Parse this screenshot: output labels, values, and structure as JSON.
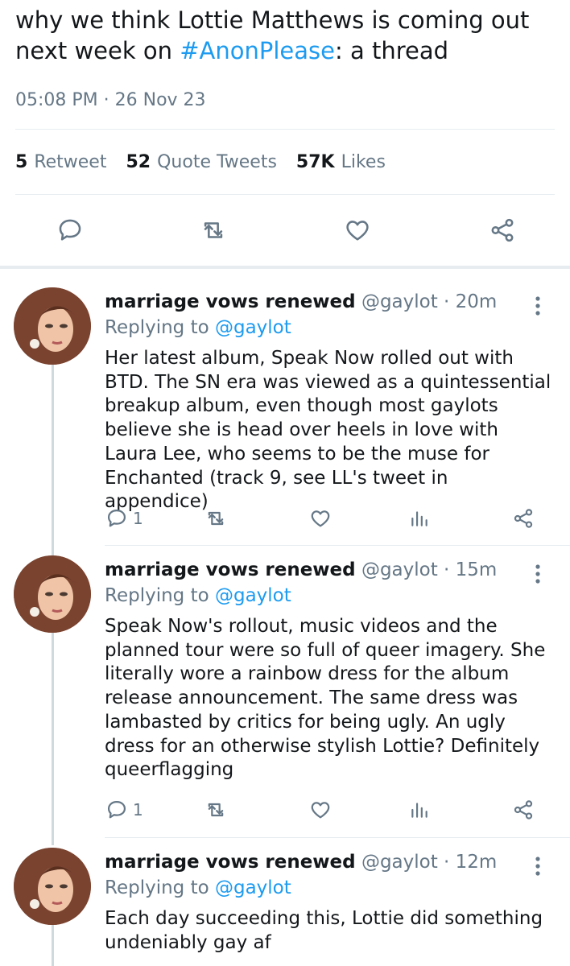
{
  "main_tweet": {
    "text_before": "why we think Lottie Matthews is coming out next week on ",
    "hashtag": "#AnonPlease",
    "text_after": ": a thread",
    "timestamp": "05:08 PM · 26 Nov 23",
    "stats": {
      "retweets_count": "5",
      "retweets_label": "Retweet",
      "quotes_count": "52",
      "quotes_label": "Quote Tweets",
      "likes_count": "57K",
      "likes_label": "Likes"
    }
  },
  "replies": [
    {
      "display_name": "marriage vows renewed",
      "handle": "@gaylot",
      "time": "· 20m",
      "replying_prefix": "Replying to",
      "replying_to": "@gaylot",
      "text": "Her latest album, Speak Now rolled out with BTD. The SN era was viewed as a quintessential breakup album, even though most gaylots believe she is head over heels in love with Laura Lee, who seems to be the muse for Enchanted (track 9, see LL's tweet in appendice)",
      "reply_count": "1"
    },
    {
      "display_name": "marriage vows renewed",
      "handle": "@gaylot",
      "time": "· 15m",
      "replying_prefix": "Replying to",
      "replying_to": "@gaylot",
      "text": "Speak Now's rollout, music videos and the planned tour were so full of queer imagery. She literally wore a rainbow dress for the album release announcement. The same dress was lambasted by critics for being ugly. An ugly dress for an otherwise stylish Lottie? Definitely queerflagging",
      "reply_count": "1"
    },
    {
      "display_name": "marriage vows renewed",
      "handle": "@gaylot",
      "time": "· 12m",
      "replying_prefix": "Replying to",
      "replying_to": "@gaylot",
      "text": "Each day succeeding this, Lottie did something undeniably gay af",
      "reply_count": ""
    }
  ],
  "colors": {
    "accent": "#1d9bf0",
    "text_primary": "#14171a",
    "text_secondary": "#657786",
    "divider": "#e6ecf0"
  },
  "icons": [
    "reply-icon",
    "retweet-icon",
    "like-icon",
    "share-icon",
    "analytics-icon",
    "more-icon"
  ]
}
